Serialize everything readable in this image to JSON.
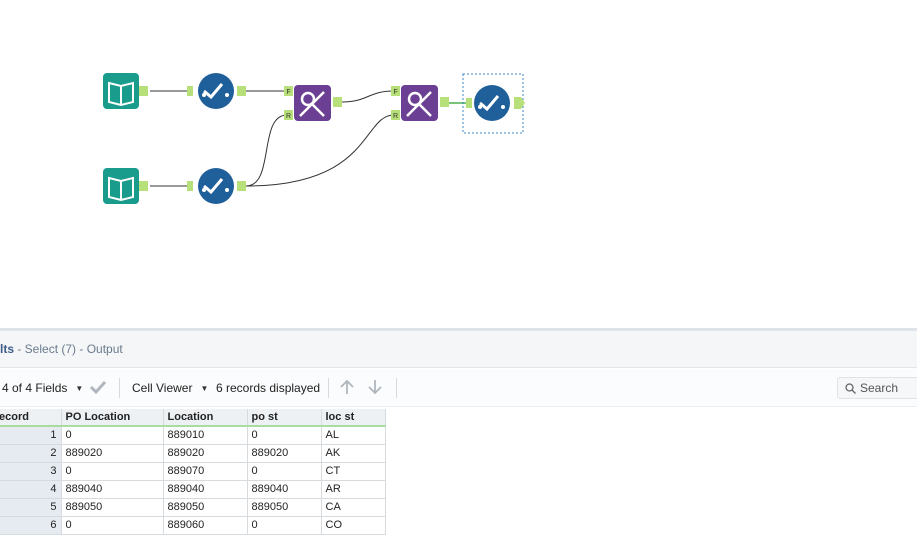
{
  "colors": {
    "input_tool": "#1a9c8c",
    "select_tool": "#1f5f9a",
    "join_tool": "#6b3f93",
    "anchor": "#b8e07a",
    "connector": "#333333",
    "selection_outline": "#3a86c8",
    "grid_header_underline": "#a8dca0"
  },
  "workflow": {
    "tools": [
      {
        "name": "input-data-tool-1",
        "icon": "book-icon"
      },
      {
        "name": "select-tool-1",
        "icon": "checkmark-icon"
      },
      {
        "name": "input-data-tool-2",
        "icon": "book-icon"
      },
      {
        "name": "select-tool-2",
        "icon": "checkmark-icon"
      },
      {
        "name": "find-replace-tool-1",
        "icon": "find-replace-icon",
        "anchor_f": "F",
        "anchor_r": "R"
      },
      {
        "name": "find-replace-tool-2",
        "icon": "find-replace-icon",
        "anchor_f": "F",
        "anchor_r": "R"
      },
      {
        "name": "select-tool-7",
        "icon": "checkmark-icon",
        "selected": true
      }
    ]
  },
  "results": {
    "header_main": "lts",
    "header_sub": " - Select (7) - Output"
  },
  "toolbar": {
    "fields_label": "4 of 4 Fields",
    "cell_viewer_label": "Cell Viewer",
    "records_label": "6 records displayed",
    "search_placeholder": "Search"
  },
  "grid": {
    "columns": [
      "ecord",
      "PO Location",
      "Location",
      "po st",
      "loc st"
    ],
    "rows": [
      [
        "1",
        "0",
        "889010",
        "0",
        "AL"
      ],
      [
        "2",
        "889020",
        "889020",
        "889020",
        "AK"
      ],
      [
        "3",
        "0",
        "889070",
        "0",
        "CT"
      ],
      [
        "4",
        "889040",
        "889040",
        "889040",
        "AR"
      ],
      [
        "5",
        "889050",
        "889050",
        "889050",
        "CA"
      ],
      [
        "6",
        "0",
        "889060",
        "0",
        "CO"
      ]
    ]
  }
}
